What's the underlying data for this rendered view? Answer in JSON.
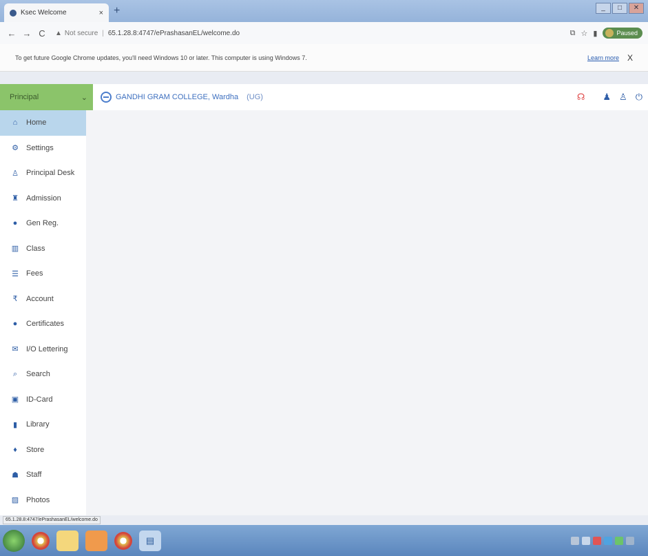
{
  "browser": {
    "tab_title": "Ksec Welcome",
    "tab_close": "×",
    "new_tab": "+",
    "window_controls": [
      "_",
      "□",
      "✕"
    ],
    "security_label": "Not secure",
    "separator": "|",
    "url": "65.1.28.8:4747/ePrashasanEL/welcome.do",
    "profile_status": "Paused",
    "infobar_message": "To get future Google Chrome updates, you'll need Windows 10 or later. This computer is using Windows 7.",
    "infobar_link": "Learn more",
    "infobar_close": "X",
    "status_url": "65.1.28.8:4747/ePrashasanEL/welcome.do"
  },
  "header": {
    "role": "Principal",
    "role_caret": "⌄",
    "college_name": "GANDHI GRAM COLLEGE, Wardha",
    "college_type": "(UG)"
  },
  "sidebar": {
    "items": [
      {
        "label": "Home",
        "icon": "home-icon"
      },
      {
        "label": "Settings",
        "icon": "gear-icon"
      },
      {
        "label": "Principal Desk",
        "icon": "user-icon"
      },
      {
        "label": "Admission",
        "icon": "graduation-cap-icon"
      },
      {
        "label": "Gen Reg.",
        "icon": "info-icon"
      },
      {
        "label": "Class",
        "icon": "building-icon"
      },
      {
        "label": "Fees",
        "icon": "list-icon"
      },
      {
        "label": "Account",
        "icon": "rupee-icon"
      },
      {
        "label": "Certificates",
        "icon": "certificate-icon"
      },
      {
        "label": "I/O Lettering",
        "icon": "envelope-icon"
      },
      {
        "label": "Search",
        "icon": "search-icon"
      },
      {
        "label": "ID-Card",
        "icon": "id-card-icon"
      },
      {
        "label": "Library",
        "icon": "book-icon"
      },
      {
        "label": "Store",
        "icon": "store-icon"
      },
      {
        "label": "Staff",
        "icon": "staff-icon"
      },
      {
        "label": "Photos",
        "icon": "image-icon"
      }
    ]
  },
  "colors": {
    "role_bg": "#8bc46a",
    "active_item": "#b9d6ec",
    "brand": "#3d6fbf"
  }
}
